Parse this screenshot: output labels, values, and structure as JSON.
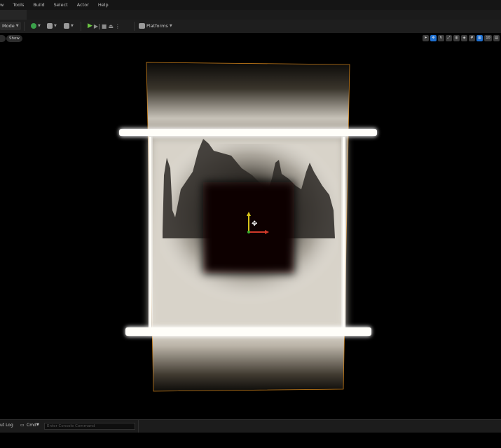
{
  "menu": {
    "items": [
      "w",
      "Tools",
      "Build",
      "Select",
      "Actor",
      "Help"
    ]
  },
  "toolbar": {
    "mode_label": "Mode",
    "platforms_label": "Platforms"
  },
  "viewport_bar": {
    "left_pill": "",
    "show_label": "Show",
    "view_count": "10"
  },
  "bottom": {
    "output_log_label": "ut Log",
    "cmd_label": "Cmd",
    "console_placeholder": "Enter Console Command"
  },
  "colors": {
    "accent_play": "#6cc644",
    "selection_blue": "#1e6fd0",
    "outline_orange": "#e8901c"
  }
}
